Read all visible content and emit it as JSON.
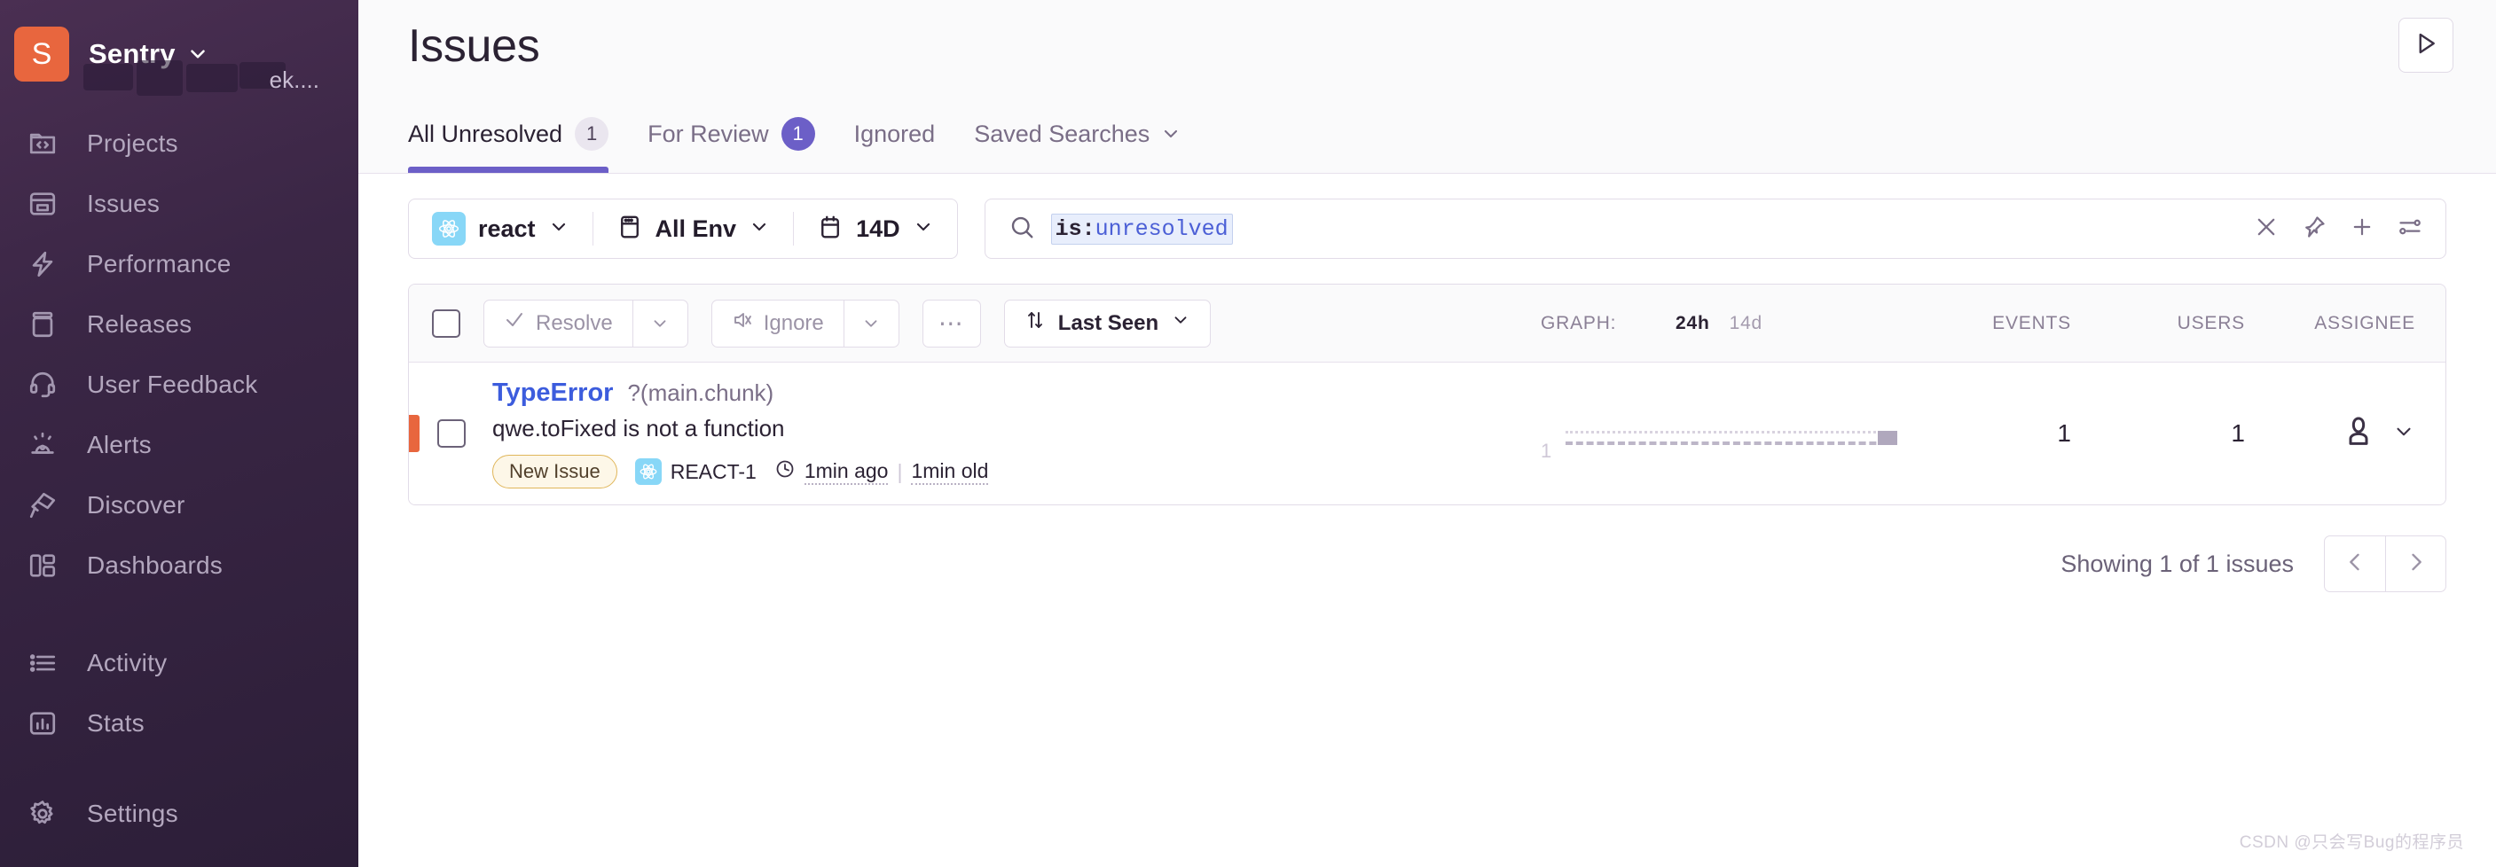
{
  "sidebar": {
    "org": {
      "avatar_letter": "S",
      "name": "Sentry",
      "blurred_text": "ek...."
    },
    "items": [
      {
        "label": "Projects",
        "icon": "projects-icon"
      },
      {
        "label": "Issues",
        "icon": "issues-icon"
      },
      {
        "label": "Performance",
        "icon": "performance-icon"
      },
      {
        "label": "Releases",
        "icon": "releases-icon"
      },
      {
        "label": "User Feedback",
        "icon": "user-feedback-icon"
      },
      {
        "label": "Alerts",
        "icon": "alerts-icon"
      },
      {
        "label": "Discover",
        "icon": "discover-icon"
      },
      {
        "label": "Dashboards",
        "icon": "dashboards-icon"
      },
      {
        "label": "Activity",
        "icon": "activity-icon"
      },
      {
        "label": "Stats",
        "icon": "stats-icon"
      },
      {
        "label": "Settings",
        "icon": "settings-icon"
      }
    ]
  },
  "header": {
    "title": "Issues",
    "play_button_icon": "play-icon",
    "tabs": [
      {
        "label": "All Unresolved",
        "badge": "1",
        "badge_style": "grey",
        "active": true
      },
      {
        "label": "For Review",
        "badge": "1",
        "badge_style": "purple",
        "active": false
      },
      {
        "label": "Ignored",
        "badge": null,
        "badge_style": null,
        "active": false
      },
      {
        "label": "Saved Searches",
        "badge": null,
        "badge_style": null,
        "active": false,
        "caret": true
      }
    ]
  },
  "filters": {
    "project": "react",
    "environment": "All Env",
    "datetime": "14D"
  },
  "search": {
    "query_key": "is:",
    "query_value": "unresolved",
    "icons": [
      "search-icon",
      "close-icon",
      "pin-icon",
      "plus-icon",
      "sliders-icon"
    ]
  },
  "toolbar": {
    "resolve_label": "Resolve",
    "ignore_label": "Ignore",
    "more_label": "⋯",
    "sort_label": "Last Seen"
  },
  "columns": {
    "graph": "GRAPH:",
    "graph_24h": "24h",
    "graph_14d": "14d",
    "events": "EVENTS",
    "users": "USERS",
    "assignee": "ASSIGNEE"
  },
  "issues": [
    {
      "type": "TypeError",
      "culprit": "?(main.chunk)",
      "message": "qwe.toFixed is not a function",
      "tag": "New Issue",
      "short_id": "REACT-1",
      "last_seen": "1min ago",
      "first_seen": "1min old",
      "events": "1",
      "users": "1",
      "level_color": "#e8663e",
      "graph_axis_label": "1"
    }
  ],
  "footer": {
    "showing": "Showing 1 of 1 issues",
    "prev_icon": "chevron-left-icon",
    "next_icon": "chevron-right-icon"
  },
  "watermark": "CSDN @只会写Bug的程序员",
  "colors": {
    "accent": "#6c5fc7",
    "link": "#3c5cdd",
    "level_error": "#e8663e",
    "sidebar": "#36233f"
  }
}
